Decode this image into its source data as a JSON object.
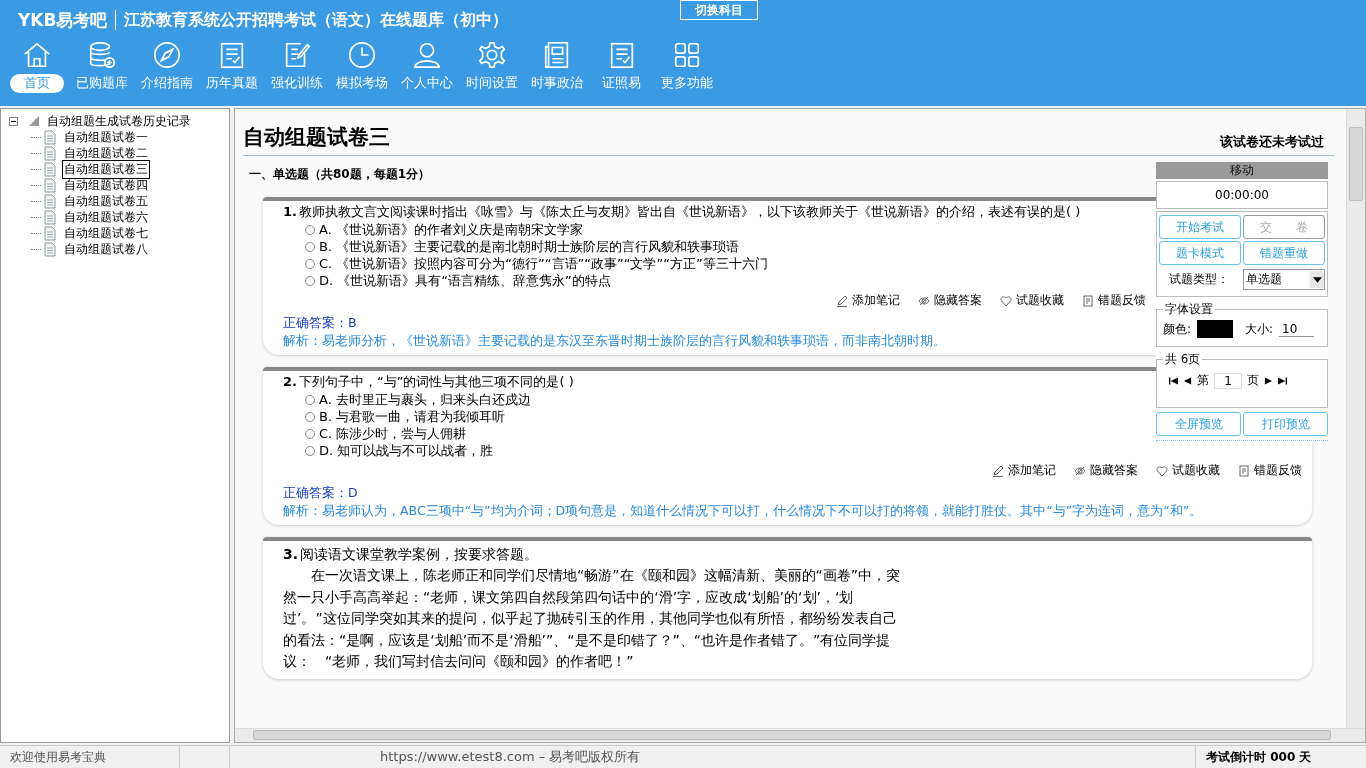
{
  "header": {
    "logo": "YKB易考吧",
    "title": "江苏教育系统公开招聘考试（语文）在线题库（初中）",
    "switch_button": "切换科目"
  },
  "nav": [
    {
      "label": "首页",
      "selected": true
    },
    {
      "label": "已购题库",
      "selected": false
    },
    {
      "label": "介绍指南",
      "selected": false
    },
    {
      "label": "历年真题",
      "selected": false
    },
    {
      "label": "强化训练",
      "selected": false
    },
    {
      "label": "模拟考场",
      "selected": false
    },
    {
      "label": "个人中心",
      "selected": false
    },
    {
      "label": "时间设置",
      "selected": false
    },
    {
      "label": "时事政治",
      "selected": false
    },
    {
      "label": "证照易",
      "selected": false
    },
    {
      "label": "更多功能",
      "selected": false
    }
  ],
  "tree": {
    "label": "自动组题生成试卷历史记录",
    "expanded": true,
    "children": [
      {
        "label": "自动组题试卷一",
        "selected": false
      },
      {
        "label": "自动组题试卷二",
        "selected": false
      },
      {
        "label": "自动组题试卷三",
        "selected": true
      },
      {
        "label": "自动组题试卷四",
        "selected": false
      },
      {
        "label": "自动组题试卷五",
        "selected": false
      },
      {
        "label": "自动组题试卷六",
        "selected": false
      },
      {
        "label": "自动组题试卷七",
        "selected": false
      },
      {
        "label": "自动组题试卷八",
        "selected": false
      }
    ]
  },
  "paper": {
    "title": "自动组题试卷三",
    "status": "该试卷还未考试过",
    "section": "一、单选题（共80题，每题1分）",
    "questions": [
      {
        "kind": "choice",
        "number": "1.",
        "text": "教师执教文言文阅读课时指出《咏雪》与《陈太丘与友期》皆出自《世说新语》，以下该教师关于《世说新语》的介绍，表述有误的是( )",
        "options": [
          {
            "text": "A. 《世说新语》的作者刘义庆是南朝宋文学家",
            "selected": false
          },
          {
            "text": "B. 《世说新语》主要记载的是南北朝时期士族阶层的言行风貌和轶事琐语",
            "selected": false
          },
          {
            "text": "C. 《世说新语》按照内容可分为“德行”“言语”“政事”“文学”“方正”等三十六门",
            "selected": false
          },
          {
            "text": "D. 《世说新语》具有“语言精练、辞意隽永”的特点",
            "selected": false
          }
        ],
        "actions": [
          "添加笔记",
          "隐藏答案",
          "试题收藏",
          "错题反馈"
        ],
        "answer_label": "正确答案：",
        "answer": "B",
        "explanation": "解析：易老师分析，《世说新语》主要记载的是东汉至东晋时期士族阶层的言行风貌和轶事琐语，而非南北朝时期。"
      },
      {
        "kind": "choice",
        "number": "2.",
        "text": "下列句子中，“与”的词性与其他三项不同的是( )",
        "options": [
          {
            "text": "A. 去时里正与裹头，归来头白还戍边",
            "selected": false
          },
          {
            "text": "B. 与君歌一曲，请君为我倾耳听",
            "selected": false
          },
          {
            "text": "C. 陈涉少时，尝与人佣耕",
            "selected": false
          },
          {
            "text": "D. 知可以战与不可以战者，胜",
            "selected": false
          }
        ],
        "actions": [
          "添加笔记",
          "隐藏答案",
          "试题收藏",
          "错题反馈"
        ],
        "answer_label": "正确答案：",
        "answer": "D",
        "explanation": "解析：易老师认为，ABC三项中“与”均为介词；D项句意是，知道什么情况下可以打，什么情况下不可以打的将领，就能打胜仗。其中“与”字为连词，意为“和”。"
      },
      {
        "kind": "reading",
        "number": "3.",
        "text": "阅读语文课堂教学案例，按要求答题。",
        "passage": "在一次语文课上，陈老师正和同学们尽情地“畅游”在《颐和园》这幅清新、美丽的“画卷”中，突然一只小手高高举起：“老师，课文第四自然段第四句话中的‘滑’字，应改成‘划船’的‘划’，‘划过’。”这位同学突如其来的提问，似乎起了抛砖引玉的作用，其他同学也似有所悟，都纷纷发表自己的看法：“是啊，应该是‘划船’而不是‘滑船’”、“是不是印错了？”、“也许是作者错了。”有位同学提议：　“老师，我们写封信去问问《颐和园》的作者吧！”"
      }
    ]
  },
  "panel": {
    "move": "移动",
    "timer": "00:00:00",
    "buttons": [
      {
        "label": "开始考试",
        "disabled": false
      },
      {
        "label": "交　　卷",
        "disabled": true
      },
      {
        "label": "题卡模式",
        "disabled": false
      },
      {
        "label": "错题重做",
        "disabled": false
      }
    ],
    "type_label": "试题类型：",
    "type_value": "单选题",
    "font_legend": "字体设置",
    "color_label": "颜色:",
    "color": "#000000",
    "size_label": "大小:",
    "size_value": "10",
    "pages_legend": "共 6页",
    "page_prefix": "第",
    "page_value": "1",
    "page_suffix": "页",
    "preview_buttons": [
      "全屏预览",
      "打印预览"
    ]
  },
  "status_bar": {
    "welcome": "欢迎使用易考宝典",
    "copyright": "https://www.etest8.com – 易考吧版权所有",
    "countdown": "考试倒计时 000 天"
  }
}
